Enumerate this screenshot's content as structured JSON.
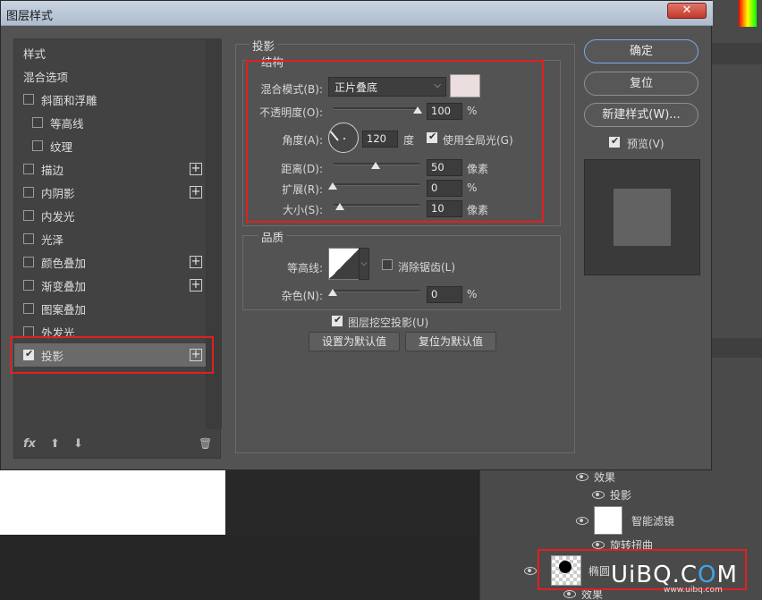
{
  "dialog": {
    "title": "图层样式",
    "close_label": "✕"
  },
  "style_list": {
    "header_styles": "样式",
    "header_blending": "混合选项",
    "items": [
      {
        "label": "斜面和浮雕",
        "checked": false,
        "has_add": false,
        "indent": false
      },
      {
        "label": "等高线",
        "checked": false,
        "has_add": false,
        "indent": true
      },
      {
        "label": "纹理",
        "checked": false,
        "has_add": false,
        "indent": true
      },
      {
        "label": "描边",
        "checked": false,
        "has_add": true,
        "indent": false
      },
      {
        "label": "内阴影",
        "checked": false,
        "has_add": true,
        "indent": false
      },
      {
        "label": "内发光",
        "checked": false,
        "has_add": false,
        "indent": false
      },
      {
        "label": "光泽",
        "checked": false,
        "has_add": false,
        "indent": false
      },
      {
        "label": "颜色叠加",
        "checked": false,
        "has_add": true,
        "indent": false
      },
      {
        "label": "渐变叠加",
        "checked": false,
        "has_add": true,
        "indent": false
      },
      {
        "label": "图案叠加",
        "checked": false,
        "has_add": false,
        "indent": false
      },
      {
        "label": "外发光",
        "checked": false,
        "has_add": false,
        "indent": false
      },
      {
        "label": "投影",
        "checked": true,
        "has_add": true,
        "indent": false,
        "selected": true
      }
    ],
    "footer": {
      "fx": "fx",
      "up": "⬆",
      "down": "⬇",
      "trash": "🗑"
    }
  },
  "drop_shadow": {
    "group_title": "投影",
    "structure_title": "结构",
    "blend_mode_label": "混合模式(B):",
    "blend_mode_value": "正片叠底",
    "shadow_color": "#ecdede",
    "opacity_label": "不透明度(O):",
    "opacity_value": "100",
    "opacity_unit": "%",
    "angle_label": "角度(A):",
    "angle_value": "120",
    "angle_unit": "度",
    "global_light_label": "使用全局光(G)",
    "global_light_checked": true,
    "distance_label": "距离(D):",
    "distance_value": "50",
    "distance_unit": "像素",
    "spread_label": "扩展(R):",
    "spread_value": "0",
    "spread_unit": "%",
    "size_label": "大小(S):",
    "size_value": "10",
    "size_unit": "像素",
    "quality_title": "品质",
    "contour_label": "等高线:",
    "antialias_label": "消除锯齿(L)",
    "antialias_checked": false,
    "noise_label": "杂色(N):",
    "noise_value": "0",
    "noise_unit": "%",
    "knockout_label": "图层挖空投影(U)",
    "knockout_checked": true,
    "make_default_label": "设置为默认值",
    "reset_default_label": "复位为默认值"
  },
  "actions": {
    "ok_label": "确定",
    "reset_label": "复位",
    "new_style_label": "新建样式(W)...",
    "preview_label": "预览(V)",
    "preview_checked": true
  },
  "layers_panel": {
    "effects_label": "效果",
    "drop_shadow_label": "投影",
    "smart_filter_label": "智能滤镜",
    "twirl_label": "旋转扭曲",
    "layer_name": "椭圆",
    "effects_label_2": "效果"
  },
  "watermark": {
    "text_a": "Ui",
    "text_b": "BQ.C",
    "text_o": "O",
    "text_c": "M",
    "sub": "www.uibq.com"
  }
}
